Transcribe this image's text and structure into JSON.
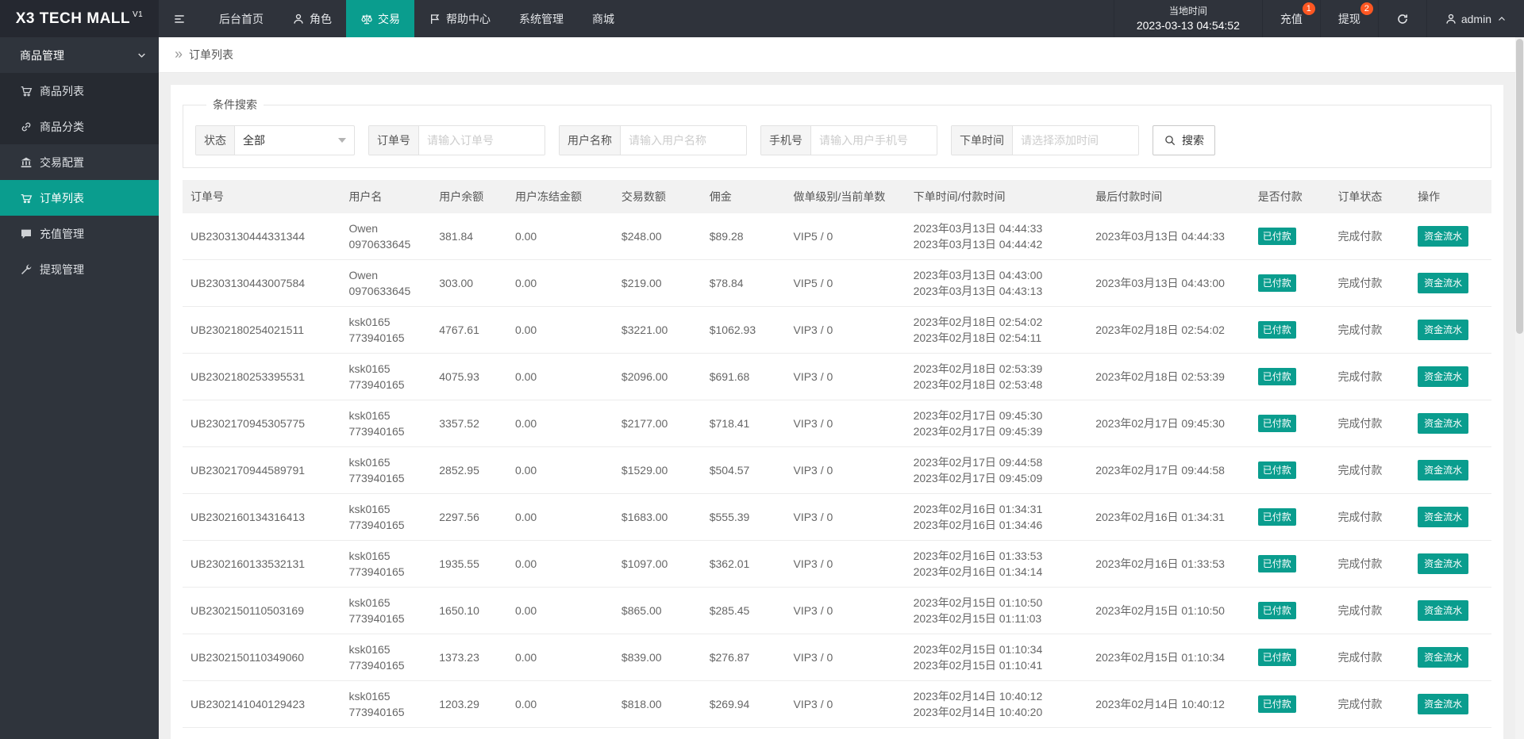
{
  "colors": {
    "accent": "#0a9d8e",
    "badge": "#ff5722"
  },
  "header": {
    "logo_title": "X3 TECH MALL",
    "logo_version": "V1",
    "nav": [
      {
        "label": "后台首页"
      },
      {
        "label": "角色"
      },
      {
        "label": "交易"
      },
      {
        "label": "帮助中心"
      },
      {
        "label": "系统管理"
      },
      {
        "label": "商城"
      }
    ],
    "local_time_label": "当地时间",
    "local_time_value": "2023-03-13 04:54:52",
    "recharge": {
      "label": "充值",
      "badge": "1"
    },
    "withdraw": {
      "label": "提现",
      "badge": "2"
    },
    "username": "admin"
  },
  "sidebar": {
    "group_label": "商品管理",
    "items": [
      {
        "label": "商品列表"
      },
      {
        "label": "商品分类"
      },
      {
        "label": "交易配置"
      },
      {
        "label": "订单列表"
      },
      {
        "label": "充值管理"
      },
      {
        "label": "提现管理"
      }
    ]
  },
  "breadcrumb": {
    "current": "订单列表"
  },
  "search": {
    "legend": "条件搜索",
    "status_label": "状态",
    "status_value": "全部",
    "order_label": "订单号",
    "order_placeholder": "请输入订单号",
    "user_label": "用户名称",
    "user_placeholder": "请输入用户名称",
    "phone_label": "手机号",
    "phone_placeholder": "请输入用户手机号",
    "time_label": "下单时间",
    "time_placeholder": "请选择添加时间",
    "button_label": "搜索"
  },
  "table": {
    "columns": [
      "订单号",
      "用户名",
      "用户余额",
      "用户冻结金额",
      "交易数额",
      "佣金",
      "做单级别/当前单数",
      "下单时间/付款时间",
      "最后付款时间",
      "是否付款",
      "订单状态",
      "操作"
    ],
    "rows": [
      {
        "order_no": "UB2303130444331344",
        "user_name": "Owen",
        "user_account": "0970633645",
        "balance": "381.84",
        "frozen": "0.00",
        "amount": "$248.00",
        "commission": "$89.28",
        "level": "VIP5 / 0",
        "order_time": "2023年03月13日 04:44:33",
        "pay_time": "2023年03月13日 04:44:42",
        "last_pay_time": "2023年03月13日 04:44:33",
        "paid_label": "已付款",
        "status_label": "完成付款",
        "action_label": "资金流水"
      },
      {
        "order_no": "UB2303130443007584",
        "user_name": "Owen",
        "user_account": "0970633645",
        "balance": "303.00",
        "frozen": "0.00",
        "amount": "$219.00",
        "commission": "$78.84",
        "level": "VIP5 / 0",
        "order_time": "2023年03月13日 04:43:00",
        "pay_time": "2023年03月13日 04:43:13",
        "last_pay_time": "2023年03月13日 04:43:00",
        "paid_label": "已付款",
        "status_label": "完成付款",
        "action_label": "资金流水"
      },
      {
        "order_no": "UB2302180254021511",
        "user_name": "ksk0165",
        "user_account": "773940165",
        "balance": "4767.61",
        "frozen": "0.00",
        "amount": "$3221.00",
        "commission": "$1062.93",
        "level": "VIP3 / 0",
        "order_time": "2023年02月18日 02:54:02",
        "pay_time": "2023年02月18日 02:54:11",
        "last_pay_time": "2023年02月18日 02:54:02",
        "paid_label": "已付款",
        "status_label": "完成付款",
        "action_label": "资金流水"
      },
      {
        "order_no": "UB2302180253395531",
        "user_name": "ksk0165",
        "user_account": "773940165",
        "balance": "4075.93",
        "frozen": "0.00",
        "amount": "$2096.00",
        "commission": "$691.68",
        "level": "VIP3 / 0",
        "order_time": "2023年02月18日 02:53:39",
        "pay_time": "2023年02月18日 02:53:48",
        "last_pay_time": "2023年02月18日 02:53:39",
        "paid_label": "已付款",
        "status_label": "完成付款",
        "action_label": "资金流水"
      },
      {
        "order_no": "UB2302170945305775",
        "user_name": "ksk0165",
        "user_account": "773940165",
        "balance": "3357.52",
        "frozen": "0.00",
        "amount": "$2177.00",
        "commission": "$718.41",
        "level": "VIP3 / 0",
        "order_time": "2023年02月17日 09:45:30",
        "pay_time": "2023年02月17日 09:45:39",
        "last_pay_time": "2023年02月17日 09:45:30",
        "paid_label": "已付款",
        "status_label": "完成付款",
        "action_label": "资金流水"
      },
      {
        "order_no": "UB2302170944589791",
        "user_name": "ksk0165",
        "user_account": "773940165",
        "balance": "2852.95",
        "frozen": "0.00",
        "amount": "$1529.00",
        "commission": "$504.57",
        "level": "VIP3 / 0",
        "order_time": "2023年02月17日 09:44:58",
        "pay_time": "2023年02月17日 09:45:09",
        "last_pay_time": "2023年02月17日 09:44:58",
        "paid_label": "已付款",
        "status_label": "完成付款",
        "action_label": "资金流水"
      },
      {
        "order_no": "UB2302160134316413",
        "user_name": "ksk0165",
        "user_account": "773940165",
        "balance": "2297.56",
        "frozen": "0.00",
        "amount": "$1683.00",
        "commission": "$555.39",
        "level": "VIP3 / 0",
        "order_time": "2023年02月16日 01:34:31",
        "pay_time": "2023年02月16日 01:34:46",
        "last_pay_time": "2023年02月16日 01:34:31",
        "paid_label": "已付款",
        "status_label": "完成付款",
        "action_label": "资金流水"
      },
      {
        "order_no": "UB2302160133532131",
        "user_name": "ksk0165",
        "user_account": "773940165",
        "balance": "1935.55",
        "frozen": "0.00",
        "amount": "$1097.00",
        "commission": "$362.01",
        "level": "VIP3 / 0",
        "order_time": "2023年02月16日 01:33:53",
        "pay_time": "2023年02月16日 01:34:14",
        "last_pay_time": "2023年02月16日 01:33:53",
        "paid_label": "已付款",
        "status_label": "完成付款",
        "action_label": "资金流水"
      },
      {
        "order_no": "UB2302150110503169",
        "user_name": "ksk0165",
        "user_account": "773940165",
        "balance": "1650.10",
        "frozen": "0.00",
        "amount": "$865.00",
        "commission": "$285.45",
        "level": "VIP3 / 0",
        "order_time": "2023年02月15日 01:10:50",
        "pay_time": "2023年02月15日 01:11:03",
        "last_pay_time": "2023年02月15日 01:10:50",
        "paid_label": "已付款",
        "status_label": "完成付款",
        "action_label": "资金流水"
      },
      {
        "order_no": "UB2302150110349060",
        "user_name": "ksk0165",
        "user_account": "773940165",
        "balance": "1373.23",
        "frozen": "0.00",
        "amount": "$839.00",
        "commission": "$276.87",
        "level": "VIP3 / 0",
        "order_time": "2023年02月15日 01:10:34",
        "pay_time": "2023年02月15日 01:10:41",
        "last_pay_time": "2023年02月15日 01:10:34",
        "paid_label": "已付款",
        "status_label": "完成付款",
        "action_label": "资金流水"
      },
      {
        "order_no": "UB2302141040129423",
        "user_name": "ksk0165",
        "user_account": "773940165",
        "balance": "1203.29",
        "frozen": "0.00",
        "amount": "$818.00",
        "commission": "$269.94",
        "level": "VIP3 / 0",
        "order_time": "2023年02月14日 10:40:12",
        "pay_time": "2023年02月14日 10:40:20",
        "last_pay_time": "2023年02月14日 10:40:12",
        "paid_label": "已付款",
        "status_label": "完成付款",
        "action_label": "资金流水"
      }
    ]
  }
}
